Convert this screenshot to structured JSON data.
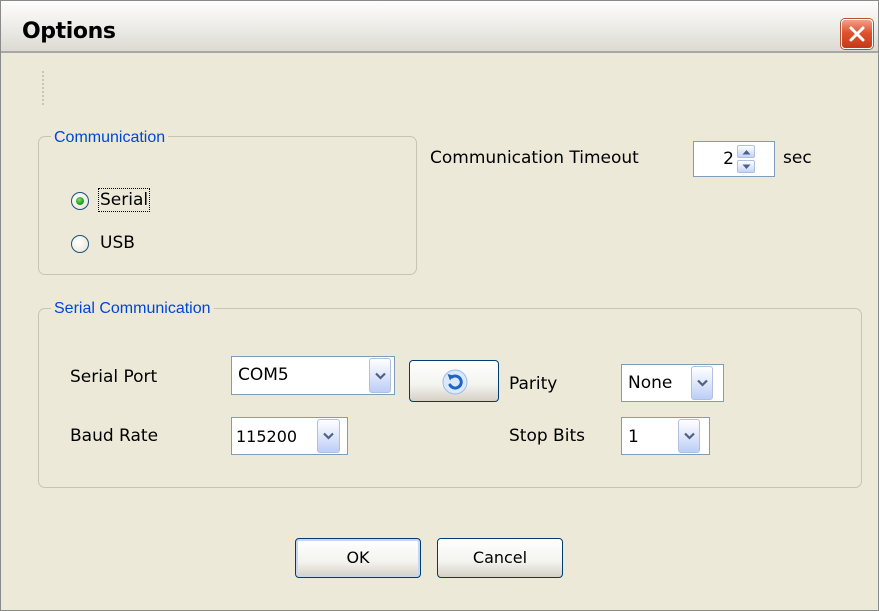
{
  "window": {
    "title": "Options"
  },
  "communication": {
    "group_title": "Communication",
    "options": [
      {
        "label": "Serial",
        "selected": true
      },
      {
        "label": "USB",
        "selected": false
      }
    ],
    "timeout": {
      "label": "Communication  Timeout",
      "value": "2",
      "unit": "sec"
    }
  },
  "serial": {
    "group_title": "Serial Communication",
    "port": {
      "label": "Serial Port",
      "value": "COM5"
    },
    "baud": {
      "label": "Baud Rate",
      "value": "115200"
    },
    "parity": {
      "label": "Parity",
      "value": "None"
    },
    "stop_bits": {
      "label": "Stop Bits",
      "value": "1"
    }
  },
  "buttons": {
    "ok": "OK",
    "cancel": "Cancel"
  },
  "icons": {
    "close": "close-icon",
    "refresh": "refresh-icon",
    "dropdown": "chevron-down-icon",
    "spin_up": "arrow-up-icon",
    "spin_down": "arrow-down-icon"
  },
  "colors": {
    "group_title": "#0046d5",
    "window_bg": "#ece9d8",
    "close_button": "#e0522f",
    "radio_selected": "#21a121"
  }
}
